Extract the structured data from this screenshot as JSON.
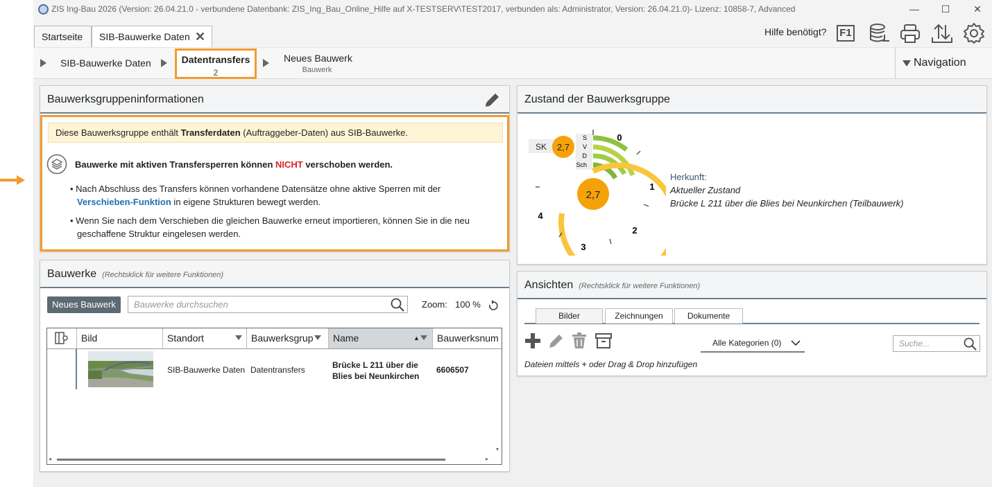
{
  "titlebar": {
    "title": "ZIS Ing-Bau 2026 (Version: 26.04.21.0 - verbundene Datenbank: ZIS_Ing_Bau_Online_Hilfe auf X-TESTSERV\\TEST2017, verbunden als: Administrator, Version: 26.04.21.0)- Lizenz: 10858-7, Advanced",
    "minimize": "—",
    "maximize": "☐",
    "close": "✕"
  },
  "tabs": [
    {
      "label": "Startseite"
    },
    {
      "label": "SIB-Bauwerke Daten",
      "close": "✕"
    }
  ],
  "toolbar": {
    "help_label": "Hilfe benötigt?",
    "f1_label": "F1"
  },
  "breadcrumb": {
    "items": [
      {
        "label": "SIB-Bauwerke Daten"
      },
      {
        "label": "Datentransfers",
        "sub": "2"
      },
      {
        "label": "Neues Bauwerk",
        "sub": "Bauwerk"
      }
    ],
    "navigation_label": "Navigation"
  },
  "info_panel": {
    "title": "Bauwerksgruppeninformationen",
    "note_prefix": "Diese Bauwerksgruppe enthält ",
    "note_bold": "Transferdaten",
    "note_suffix": " (Auftraggeber-Daten) aus SIB-Bauwerke.",
    "warning_prefix": "Bauwerke mit aktiven Transfersperren können ",
    "warning_red": "NICHT",
    "warning_suffix": " verschoben werden.",
    "bullet1_prefix": "• Nach Abschluss des Transfers können vorhandene Datensätze ohne aktive Sperren mit der",
    "bullet1_link": "Verschieben-Funktion",
    "bullet1_suffix": " in eigene Strukturen bewegt werden.",
    "bullet2_line1": "• Wenn Sie nach dem Verschieben die gleichen Bauwerke erneut importieren, können Sie in die neu",
    "bullet2_line2": "geschaffene Struktur eingelesen werden."
  },
  "bauwerke_panel": {
    "title": "Bauwerke",
    "hint": "(Rechtsklick für weitere Funktionen)",
    "new_button": "Neues Bauwerk",
    "search_placeholder": "Bauwerke durchsuchen",
    "zoom_label": "Zoom:",
    "zoom_value": "100 %",
    "columns": [
      "Bild",
      "Standort",
      "Bauwerksgrup",
      "Name",
      "Bauwerksnum"
    ],
    "rows": [
      {
        "standort": "SIB-Bauwerke Daten",
        "gruppe": "Datentransfers",
        "name_line1": "Brücke L 211 über die",
        "name_line2": "Blies bei Neunkirchen",
        "nummer": "6606507"
      }
    ]
  },
  "zustand_panel": {
    "title": "Zustand der Bauwerksgruppe",
    "sk_label": "SK",
    "sk_value": "2,7",
    "center_value": "2,7",
    "ring_labels": [
      "S",
      "V",
      "D",
      "Sch"
    ],
    "scale_labels": [
      "0",
      "1",
      "2",
      "3",
      "4"
    ],
    "herkunft_label": "Herkunft:",
    "herkunft_line1": "Aktueller Zustand",
    "herkunft_line2": "Brücke L 211 über die Blies bei Neunkirchen (Teilbauwerk)"
  },
  "ansichten_panel": {
    "title": "Ansichten",
    "hint": "(Rechtsklick für weitere Funktionen)",
    "tabs": [
      "Bilder",
      "Zeichnungen",
      "Dokumente"
    ],
    "category_label": "Alle Kategorien (0)",
    "search_placeholder": "Suche...",
    "drop_hint_prefix": "Dateien mittels ",
    "drop_hint_suffix": " oder Drag & Drop hinzufügen"
  },
  "colors": {
    "accent_orange": "#f39a2d",
    "gauge_orange": "#f5a20a",
    "gauge_green": "#8cc23c",
    "link_blue": "#1f6fb5",
    "warning_red": "#e0202a"
  }
}
